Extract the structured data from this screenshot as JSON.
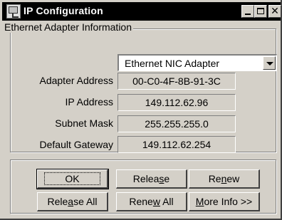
{
  "window": {
    "title": "IP Configuration"
  },
  "group": {
    "legend": "Ethernet  Adapter Information"
  },
  "adapter_select": {
    "value": "Ethernet NIC Adapter"
  },
  "fields": [
    {
      "label": "Adapter Address",
      "value": "00-C0-4F-8B-91-3C"
    },
    {
      "label": "IP Address",
      "value": "149.112.62.96"
    },
    {
      "label": "Subnet Mask",
      "value": "255.255.255.0"
    },
    {
      "label": "Default Gateway",
      "value": "149.112.62.254"
    }
  ],
  "buttons": {
    "ok": "OK",
    "release": {
      "pre": "Relea",
      "key": "s",
      "post": "e"
    },
    "renew": {
      "pre": "Re",
      "key": "n",
      "post": "ew"
    },
    "release_all": {
      "pre": "Rele",
      "key": "a",
      "post": "se All"
    },
    "renew_all": {
      "pre": "Rene",
      "key": "w",
      "post": " All"
    },
    "more_info": {
      "pre": "",
      "key": "M",
      "post": "ore Info >>"
    }
  }
}
